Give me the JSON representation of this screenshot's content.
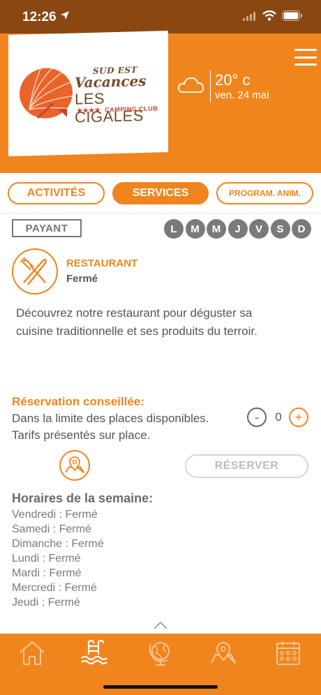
{
  "status_bar": {
    "time": "12:26"
  },
  "header": {
    "logo": {
      "brand_small": "SUD EST",
      "brand_main": "Vacances",
      "name": "LES CIGALES",
      "stars": "★★★★",
      "subtitle": "CAMPING CLUB"
    },
    "weather": {
      "temperature": "20° c",
      "date": "ven. 24 mai",
      "icon": "cloud-icon"
    },
    "menu_icon": "hamburger-icon"
  },
  "tabs": [
    {
      "label": "ACTIVITÉS",
      "active": false
    },
    {
      "label": "SERVICES",
      "active": true
    },
    {
      "label": "PROGRAM. ANIM.",
      "active": false
    }
  ],
  "service": {
    "badge": "PAYANT",
    "days": [
      "L",
      "M",
      "M",
      "J",
      "V",
      "S",
      "D"
    ],
    "title": "RESTAURANT",
    "status": "Fermé",
    "description": "Découvrez notre restaurant pour déguster sa cuisine traditionnelle et ses produits du terroir.",
    "reservation": {
      "title": "Réservation conseillée:",
      "line1": "Dans la limite des places disponibles.",
      "line2": "Tarifs présentés sur place.",
      "minus": "-",
      "quantity": "0",
      "plus": "+",
      "button": "RÉSERVER"
    },
    "hours_title": "Horaires de la semaine:",
    "hours": [
      "Vendredi : Fermé",
      "Samedi : Fermé",
      "Dimanche : Fermé",
      "Lundi : Fermé",
      "Mardi : Fermé",
      "Mercredi : Fermé",
      "Jeudi : Fermé"
    ]
  },
  "bottom_nav": [
    {
      "icon": "home-icon"
    },
    {
      "icon": "pool-icon"
    },
    {
      "icon": "globe-icon"
    },
    {
      "icon": "map-icon"
    },
    {
      "icon": "calendar-icon"
    }
  ],
  "colors": {
    "accent": "#f0851e",
    "status_bar": "#8a4712",
    "text": "#555555",
    "day_badge": "#7a7a7a"
  }
}
